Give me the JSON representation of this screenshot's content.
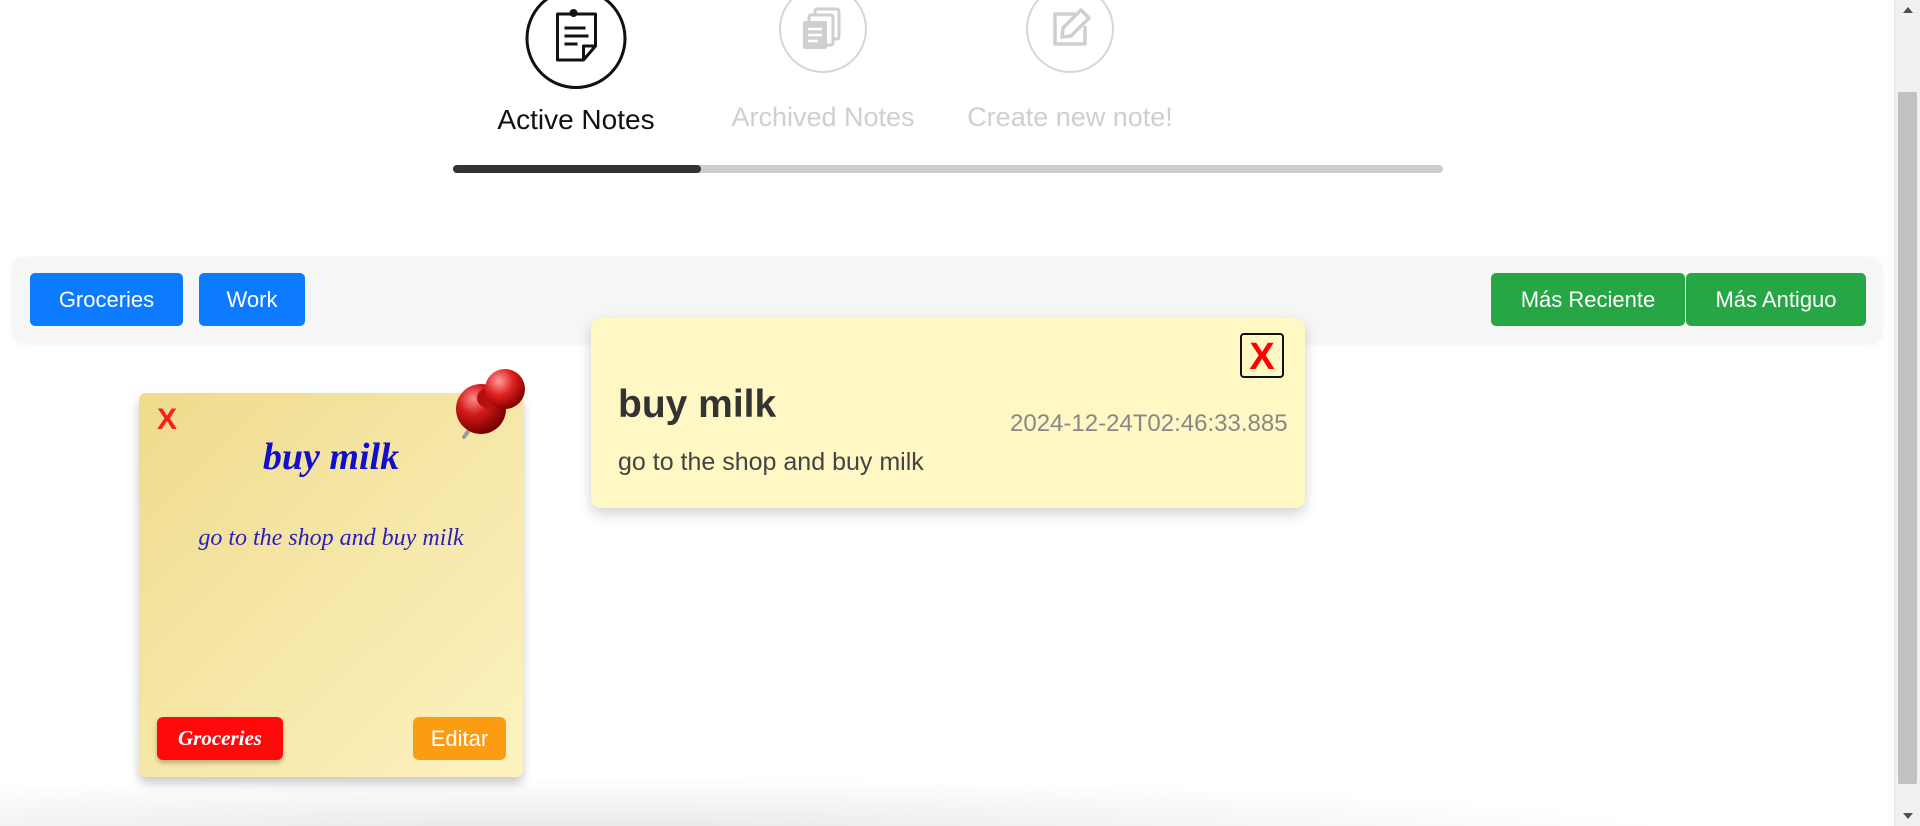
{
  "nav": {
    "steps": [
      {
        "label": "Active Notes",
        "icon": "sticky-note-icon",
        "active": true
      },
      {
        "label": "Archived Notes",
        "icon": "archive-icon",
        "active": false
      },
      {
        "label": "Create new note!",
        "icon": "edit-icon",
        "active": false
      }
    ],
    "progress_percent": 25
  },
  "filters": {
    "tags": [
      "Groceries",
      "Work"
    ],
    "sort": [
      "Más Reciente",
      "Más Antiguo"
    ]
  },
  "note": {
    "delete_label": "X",
    "title": "buy milk",
    "body": "go to the shop and buy milk",
    "tag": "Groceries",
    "edit_label": "Editar",
    "pin_icon": "pushpin-icon"
  },
  "popup": {
    "close_label": "X",
    "title": "buy milk",
    "date": "2024-12-24T02:46:33.885",
    "body": "go to the shop and buy milk"
  },
  "colors": {
    "tag_button": "#0d7bff",
    "sort_button": "#26a645",
    "note_tag": "#ff0a0a",
    "edit_button": "#fb9c12",
    "popup_bg": "#fff8c4",
    "delete_x": "#ff1c1c"
  }
}
